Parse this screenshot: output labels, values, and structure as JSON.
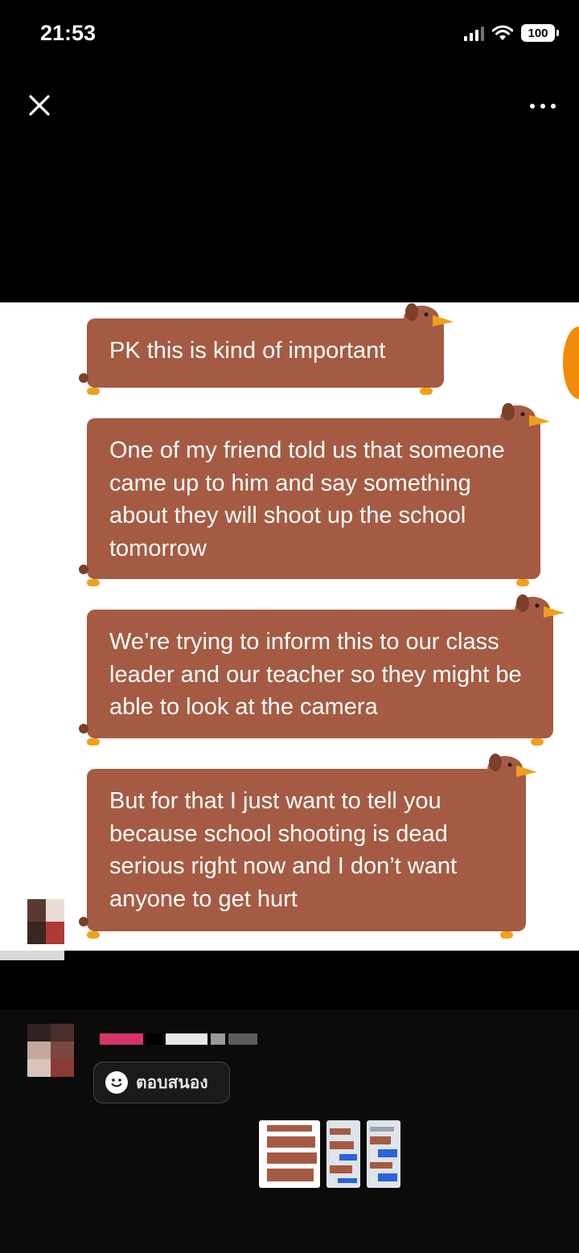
{
  "status_bar": {
    "time": "21:53",
    "battery": "100"
  },
  "messages": [
    {
      "text": "PK this is kind of important"
    },
    {
      "text": "One of my friend told us that someone came up to him and say something about they will shoot up the school tomorrow"
    },
    {
      "text": "We’re trying to inform this to our class leader and our teacher so they might be able to look at the camera"
    },
    {
      "text": "But for that I just want to tell you because school shooting is dead serious right now and I don’t want anyone to get hurt"
    }
  ],
  "comment": {
    "reply_label": "ตอบสนอง"
  },
  "colors": {
    "bubble": "#a55b43",
    "paw": "#f0a11a",
    "background": "#000000",
    "image_bg": "#ffffff"
  },
  "icons": [
    "close-icon",
    "more-icon",
    "signal-icon",
    "wifi-icon",
    "battery-icon",
    "reply-icon"
  ]
}
